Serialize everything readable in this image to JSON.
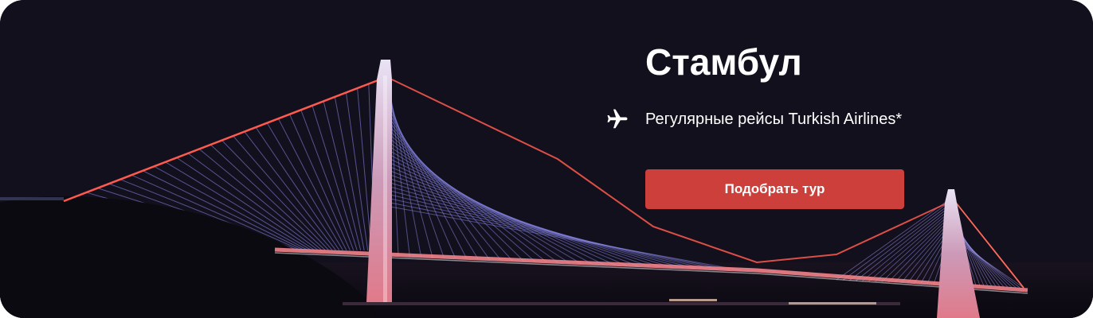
{
  "banner": {
    "title": "Стамбул",
    "feature": {
      "icon": "airplane-icon",
      "text": "Регулярные рейсы Turkish Airlines*"
    },
    "cta_label": "Подобрать тур",
    "colors": {
      "cta": "#cc3f3b",
      "text": "#ffffff",
      "sky": "#13101d"
    }
  }
}
